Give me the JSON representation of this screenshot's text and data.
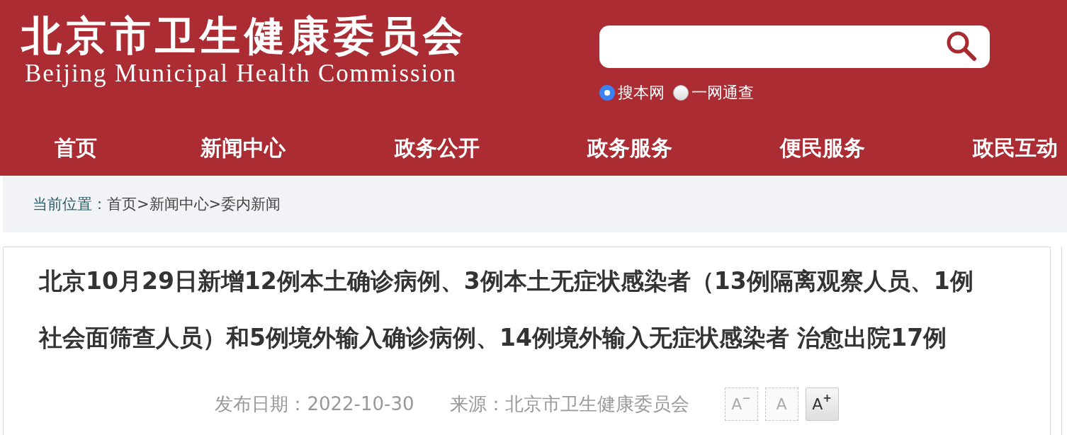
{
  "header": {
    "logo": {
      "name_zh": "北京市卫生健康委员会",
      "name_en": "Beijing Municipal Health Commission"
    },
    "search": {
      "scopes": [
        {
          "label": "搜本网",
          "selected": true
        },
        {
          "label": "一网通查",
          "selected": false
        }
      ]
    }
  },
  "nav": {
    "items": [
      {
        "label": "首页"
      },
      {
        "label": "新闻中心"
      },
      {
        "label": "政务公开"
      },
      {
        "label": "政务服务"
      },
      {
        "label": "便民服务"
      },
      {
        "label": "政民互动"
      }
    ]
  },
  "breadcrumb": {
    "prefix": "当前位置：",
    "crumbs": [
      {
        "label": "首页",
        "separator": ">"
      },
      {
        "label": "新闻中心",
        "separator": ">"
      },
      {
        "label": "委内新闻"
      }
    ]
  },
  "article": {
    "title": "北京10月29日新增12例本土确诊病例、3例本土无症状感染者（13例隔离观察人员、1例社会面筛查人员）和5例境外输入确诊病例、14例境外输入无症状感染者 治愈出院17例",
    "date": "发布日期：2022-10-30",
    "source": "来源：北京市卫生健康委员会",
    "font_buttons": [
      {
        "label": "A$^{−}$",
        "disabled": true
      },
      {
        "label": "A",
        "disabled": true
      },
      {
        "label": "A$^{+}$",
        "disabled": false
      }
    ]
  }
}
